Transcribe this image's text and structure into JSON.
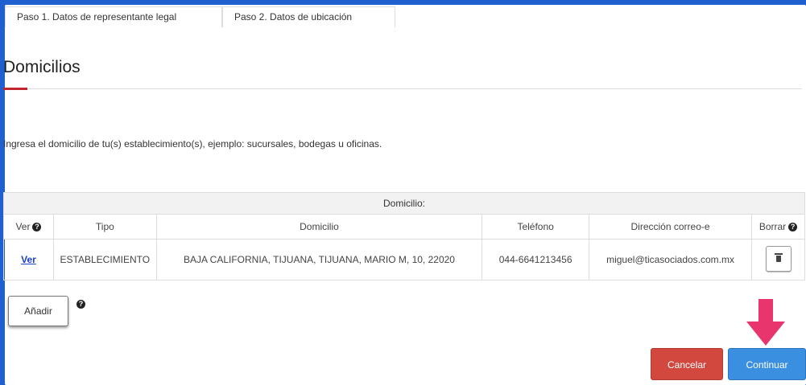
{
  "tabs": [
    {
      "label": "Paso 1. Datos de representante legal"
    },
    {
      "label": "Paso 2. Datos de ubicación"
    }
  ],
  "section": {
    "title": "Domicilios",
    "instruction": "Ingresa el domicilio de tu(s) establecimiento(s), ejemplo: sucursales, bodegas u oficinas."
  },
  "table": {
    "caption": "Domicilio:",
    "columns": [
      "Ver",
      "Tipo",
      "Domicilio",
      "Teléfono",
      "Dirección correo-e",
      "Borrar"
    ],
    "rows": [
      {
        "ver": "Ver",
        "tipo": "ESTABLECIMIENTO",
        "domicilio": "BAJA CALIFORNIA, TIJUANA, TIJUANA, MARIO M, 10, 22020",
        "telefono": "044-6641213456",
        "correo": "miguel@ticasociados.com.mx"
      }
    ]
  },
  "buttons": {
    "add": "Añadir",
    "cancel": "Cancelar",
    "continue": "Continuar"
  },
  "colors": {
    "background_blue": "#1f5fd0",
    "accent_red": "#c0242c",
    "cancel": "#d2483e",
    "continue": "#3a8fe0",
    "arrow": "#e8356d"
  },
  "icons": [
    "info-icon",
    "trash-icon",
    "arrow-down-icon"
  ]
}
